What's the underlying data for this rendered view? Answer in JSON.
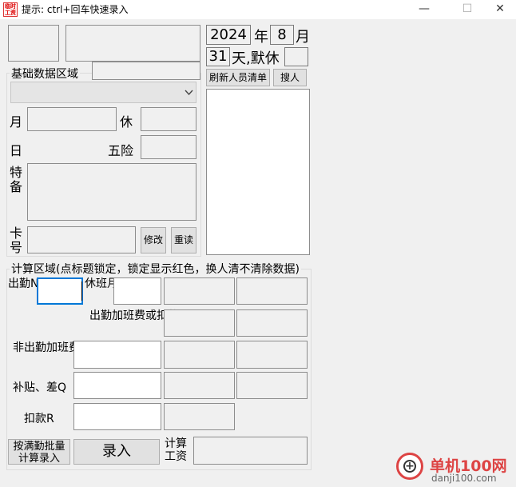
{
  "titlebar": {
    "icon_text": "临时工资",
    "title": "提示: ctrl+回车快速录入",
    "minimize_glyph": "—",
    "maximize_glyph": "☐",
    "close_glyph": "✕"
  },
  "basic": {
    "group_label": "基础数据区域",
    "month_label": "月",
    "rest_label": "休",
    "day_label": "日",
    "insurance_label": "五险",
    "special_label": "特备",
    "card_label": "卡号",
    "modify_button": "修改",
    "reread_button": "重读"
  },
  "date": {
    "year_value": "2024",
    "year_label": "年",
    "month_value": "8",
    "month_label": "月",
    "days_value": "31",
    "days_label": "天,默休",
    "default_rest_value": ""
  },
  "staff": {
    "refresh_button": "刷新人员清单",
    "search_button": "搜人"
  },
  "calc": {
    "group_label": "计算区域(点标题锁定，锁定显示红色，换人清不清除数据)",
    "attendance_label": "出勤N",
    "rest_shift_label": "休班月-N",
    "overtime_label": "出勤加班费或扣款",
    "non_attendance_label": "非出勤加班费P",
    "subsidy_label": "补贴、差Q",
    "deduction_label": "扣款R",
    "full_batch_button": "按满勤批量计算录入",
    "submit_button": "录入",
    "salary_label": "计算工资"
  },
  "watermark": {
    "site_name": "单机100网",
    "site_url": "danji100.com"
  }
}
